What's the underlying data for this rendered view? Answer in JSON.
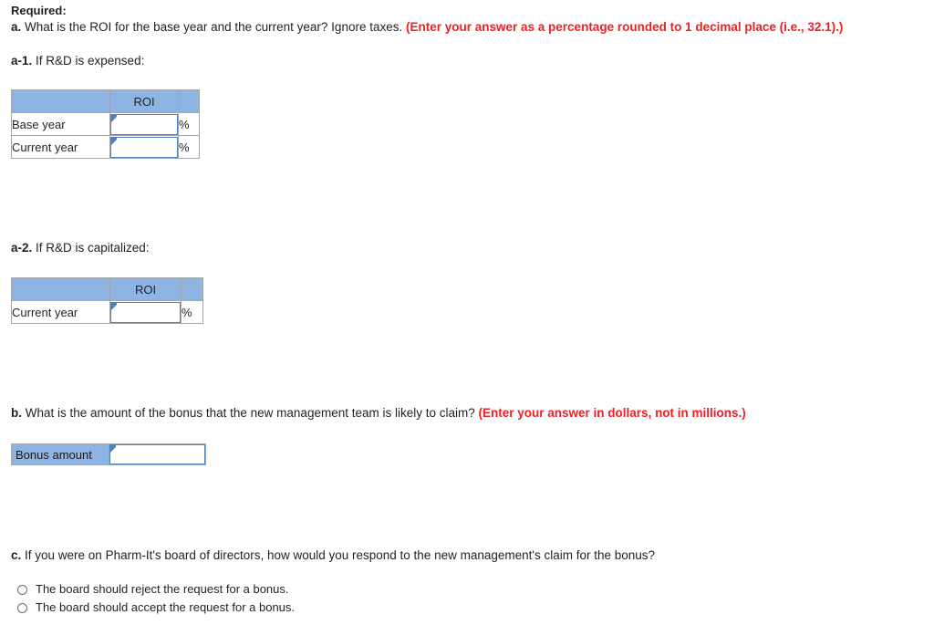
{
  "page": {
    "required_label": "Required:",
    "accent_blue": "#8eb4e3",
    "input_border_blue": "#4f81bd",
    "red": "#ed2024"
  },
  "question_a": {
    "prefix": "a.",
    "text": " What is the ROI for the base year and the current year? Ignore taxes. ",
    "hint": "(Enter your answer as a percentage rounded to 1 decimal place (i.e., 32.1).)"
  },
  "part_a1": {
    "prefix": "a-1.",
    "text": " If R&D is expensed:",
    "table": {
      "columns": [
        "",
        "ROI",
        ""
      ],
      "rows": [
        {
          "label": "Base year",
          "value": "",
          "unit": "%"
        },
        {
          "label": "Current year",
          "value": "",
          "unit": "%"
        }
      ]
    }
  },
  "part_a2": {
    "prefix": "a-2.",
    "text": " If R&D is capitalized:",
    "table": {
      "columns": [
        "",
        "ROI",
        ""
      ],
      "rows": [
        {
          "label": "Current year",
          "value": "",
          "unit": "%"
        }
      ]
    }
  },
  "question_b": {
    "prefix": "b.",
    "text": " What is the amount of the bonus that the new management team is likely to claim? ",
    "hint": "(Enter your answer in dollars, not in millions.)",
    "field": {
      "label": "Bonus amount",
      "value": ""
    }
  },
  "question_c": {
    "prefix": "c.",
    "text": " If you were on Pharm-It's board of directors, how would you respond to the new management's claim for the bonus?",
    "options": [
      {
        "label": "The board should reject the request for a bonus.",
        "selected": false
      },
      {
        "label": "The board should accept the request for a bonus.",
        "selected": false
      }
    ]
  }
}
